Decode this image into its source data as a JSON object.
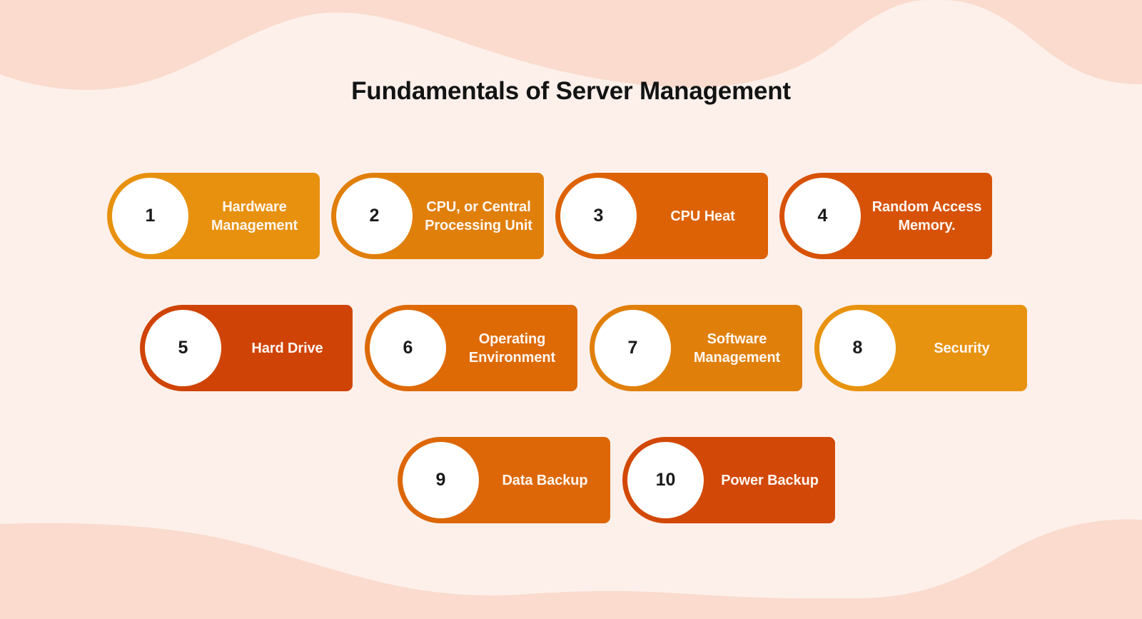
{
  "page": {
    "title": "Fundamentals of Server Management",
    "background_color": "#FDF0EB",
    "wave_color": "#FADBCD"
  },
  "rows": [
    {
      "cards": [
        {
          "number": "1",
          "label": "Hardware Management",
          "color": "#E8910E"
        },
        {
          "number": "2",
          "label": "CPU, or Central Processing Unit",
          "color": "#E17F0B"
        },
        {
          "number": "3",
          "label": "CPU Heat",
          "color": "#DD6206"
        },
        {
          "number": "4",
          "label": "Random Access Memory.",
          "color": "#D75207"
        }
      ]
    },
    {
      "cards": [
        {
          "number": "5",
          "label": "Hard Drive",
          "color": "#CF4406"
        },
        {
          "number": "6",
          "label": "Operating Environment",
          "color": "#DE6A06"
        },
        {
          "number": "7",
          "label": "Software Management",
          "color": "#E0800B"
        },
        {
          "number": "8",
          "label": "Security",
          "color": "#E8930F"
        }
      ]
    },
    {
      "cards": [
        {
          "number": "9",
          "label": "Data Backup",
          "color": "#DD6706"
        },
        {
          "number": "10",
          "label": "Power Backup",
          "color": "#D24806"
        }
      ]
    }
  ]
}
